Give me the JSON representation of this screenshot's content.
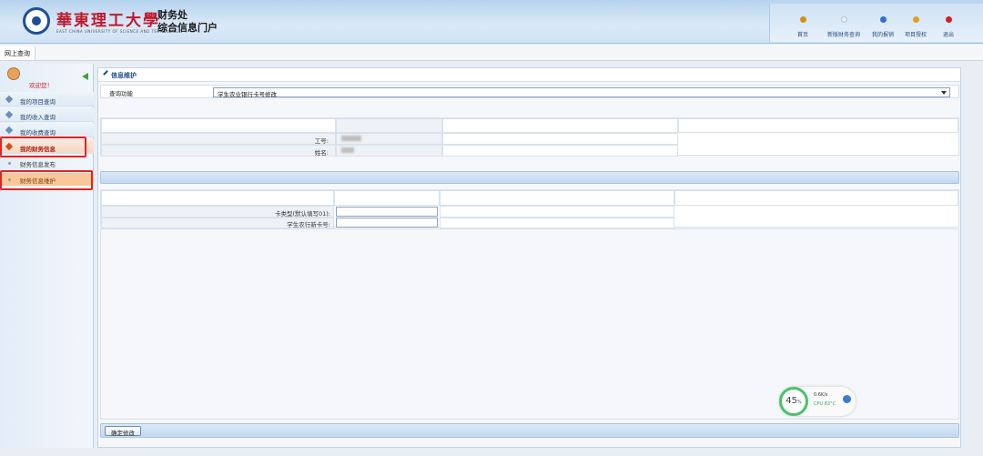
{
  "header": {
    "university_name": "華東理工大學",
    "university_sub": "EAST CHINA UNIVERSITY OF SCIENCE AND TECHNOLOGY",
    "portal_line1": "财务处",
    "portal_line2": "综合信息门户",
    "nav": [
      {
        "label": "首页",
        "color": "#d09018"
      },
      {
        "label": "新版财务查询",
        "color": "#e8eef5"
      },
      {
        "label": "我的报销",
        "color": "#2f6fd0"
      },
      {
        "label": "项目授权",
        "color": "#e0a020"
      },
      {
        "label": "退出",
        "color": "#d02020"
      }
    ]
  },
  "tabs": [
    {
      "label": "网上查询"
    }
  ],
  "sidebar": {
    "welcome": "欢迎您！",
    "items": [
      {
        "label": "我的项目查询"
      },
      {
        "label": "我的收入查询"
      },
      {
        "label": "我的收费查询"
      },
      {
        "label": "我的财务信息"
      }
    ],
    "sub_items": [
      {
        "label": "财务信息发布"
      },
      {
        "label": "财务信息维护"
      }
    ]
  },
  "main": {
    "panel_title": "信息维护",
    "query_label": "查询功能",
    "query_value": "学生农业银行卡号修改",
    "fields1": [
      {
        "label": "工号:"
      },
      {
        "label": "姓名:"
      }
    ],
    "fields2": [
      {
        "label": "卡类型(默认填写01):"
      },
      {
        "label": "学生农行新卡号:"
      }
    ],
    "confirm_button": "确定修改"
  },
  "cpu_widget": {
    "percent": "45",
    "percent_unit": "%",
    "speed": "0.6K/s",
    "temp_label": "CPU 83°C"
  }
}
